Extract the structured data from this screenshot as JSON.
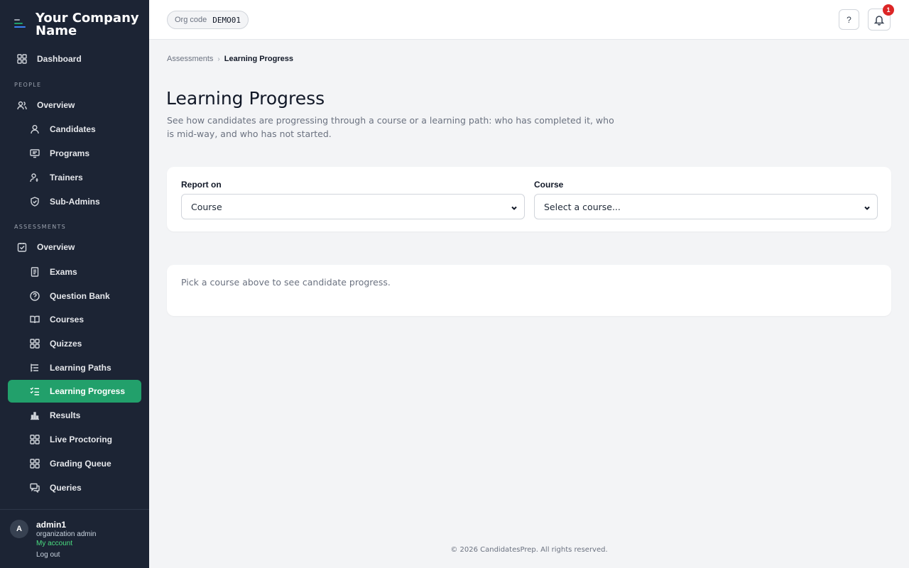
{
  "brand": {
    "name": "Your Company Name",
    "mark_colors": [
      "#9ca3af",
      "#22a06b",
      "#3b82f6"
    ]
  },
  "sidebar": {
    "dashboard": "Dashboard",
    "people_label": "PEOPLE",
    "people_overview": "Overview",
    "people_items": [
      "Candidates",
      "Programs",
      "Trainers",
      "Sub-Admins"
    ],
    "assessments_label": "ASSESSMENTS",
    "assessments_overview": "Overview",
    "assessments_items": [
      "Exams",
      "Question Bank",
      "Courses",
      "Quizzes",
      "Learning Paths",
      "Learning Progress",
      "Results",
      "Live Proctoring",
      "Grading Queue",
      "Queries"
    ],
    "active_item": "Learning Progress",
    "active_color": "#22a06b"
  },
  "user": {
    "initial": "A",
    "name": "admin1",
    "role": "organization admin",
    "my_account": "My account",
    "logout": "Log out"
  },
  "topbar": {
    "org_label": "Org code",
    "org_code": "DEMO01",
    "help": "?",
    "notifications_count": "1"
  },
  "breadcrumb": {
    "parent": "Assessments",
    "separator": "›",
    "current": "Learning Progress"
  },
  "page": {
    "title": "Learning Progress",
    "description": "See how candidates are progressing through a course or a learning path: who has completed it, who is mid-way, and who has not started."
  },
  "filters": {
    "report_on_label": "Report on",
    "report_on_value": "Course",
    "course_label": "Course",
    "course_placeholder": "Select a course..."
  },
  "empty_state": "Pick a course above to see candidate progress.",
  "footer": "© 2026 CandidatesPrep. All rights reserved."
}
